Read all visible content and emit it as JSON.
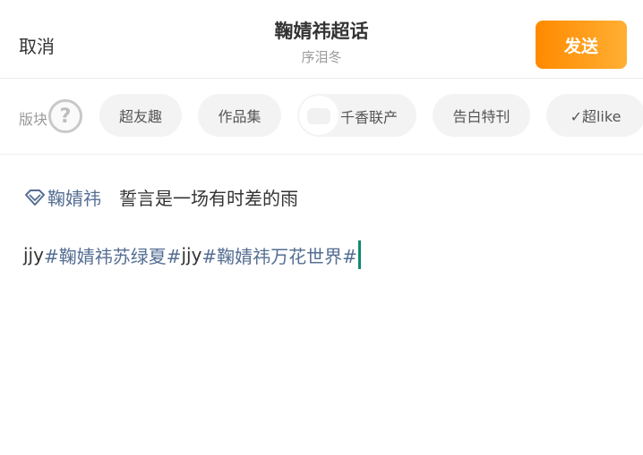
{
  "header": {
    "cancel_label": "取消",
    "title": "鞠婧祎超话",
    "subtitle": "序泪冬",
    "send_label": "发送"
  },
  "section": {
    "label": "版块",
    "help_icon": "question-circle-icon",
    "chips": [
      {
        "label": "超友趣"
      },
      {
        "label": "作品集"
      },
      {
        "label": "千香联产"
      },
      {
        "label": "告白特刊"
      },
      {
        "label": "✓超like"
      }
    ]
  },
  "editor": {
    "mention_icon": "diamond-icon",
    "mention_name": "鞠婧祎",
    "motto": "誓言是一场有时差的雨",
    "segments": [
      {
        "text": "jjy",
        "type": "plain"
      },
      {
        "text": "#鞠婧祎苏绿夏#",
        "type": "tag"
      },
      {
        "text": "jjy",
        "type": "plain"
      },
      {
        "text": "#鞠婧祎万花世界#",
        "type": "tag"
      }
    ]
  },
  "colors": {
    "accent_orange": "#ff8a00",
    "tag_blue": "#556e93",
    "cursor_green": "#0f8a70"
  }
}
